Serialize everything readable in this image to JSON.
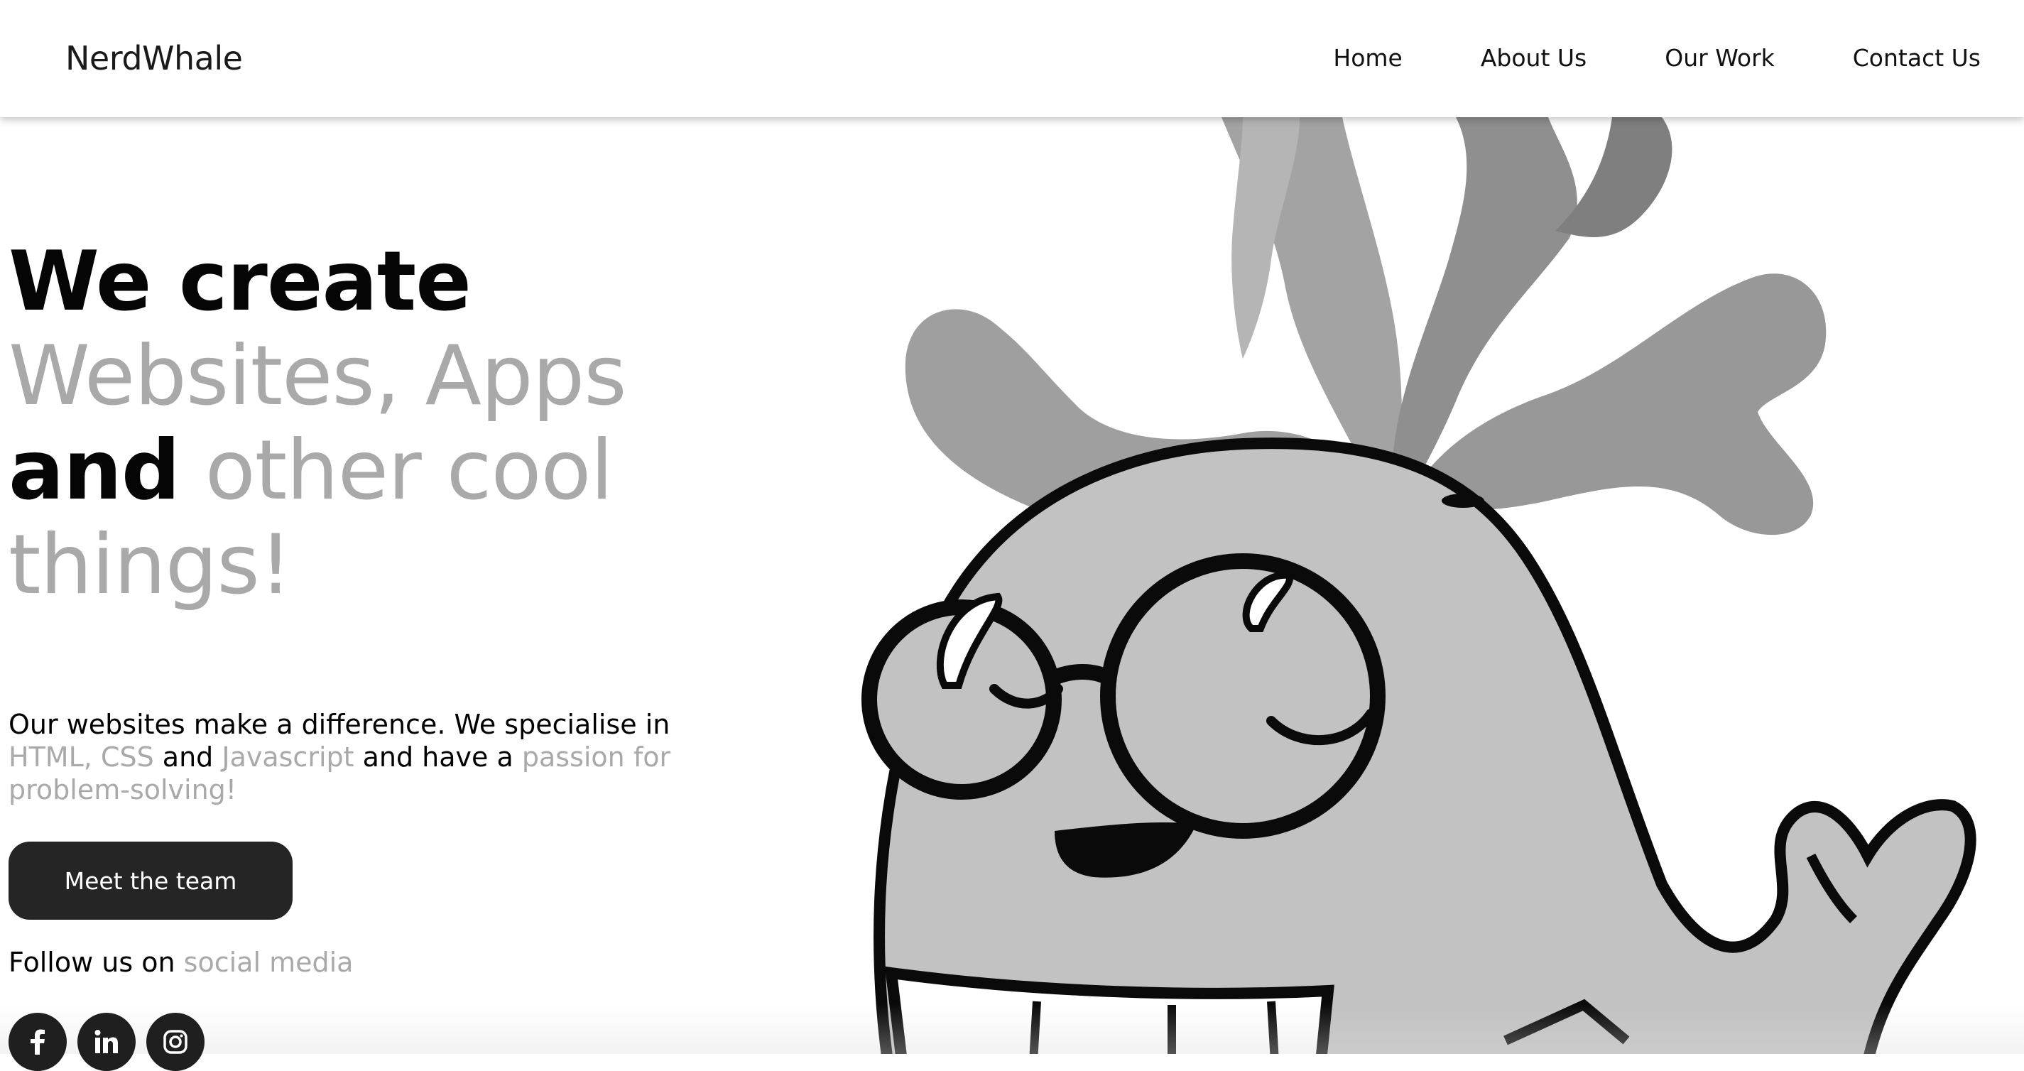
{
  "header": {
    "brand": "NerdWhale",
    "nav": [
      "Home",
      "About Us",
      "Our Work",
      "Contact Us"
    ]
  },
  "hero": {
    "line1": "We create",
    "line2": "Websites, Apps",
    "line3_bold": "and",
    "line3_light": "other cool",
    "line4": "things!"
  },
  "description": {
    "p1": "Our websites make a difference. We specialise in ",
    "h1": "HTML,",
    "p2": " ",
    "h2": "CSS",
    "p3": " and ",
    "h3": "Javascript",
    "p4": " and have a ",
    "h4": "passion for problem-solving!"
  },
  "cta": {
    "label": "Meet the team"
  },
  "follow": {
    "text": "Follow us on ",
    "highlight": "social media"
  },
  "socials": [
    "facebook-icon",
    "linkedin-icon",
    "instagram-icon"
  ],
  "colors": {
    "accent_gray": "#a9a9a9",
    "button_bg": "#252525",
    "whale_body": "#c2c2c2",
    "spout": "#9e9e9e"
  },
  "illustration": {
    "name": "nerd-whale-illustration"
  }
}
